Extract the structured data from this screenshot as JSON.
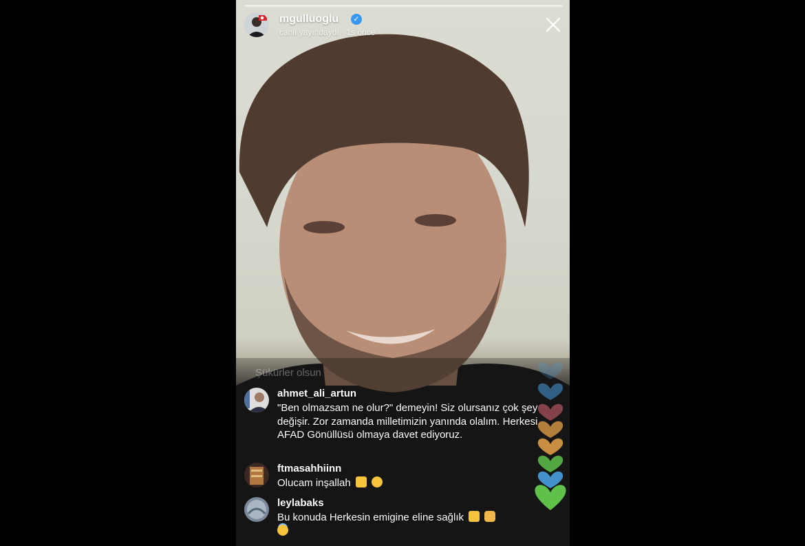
{
  "live": {
    "username": "mgulluoglu",
    "status": "canlı yayındaydı · 1s önce"
  },
  "faded_comment": "Şükürler olsun",
  "comments": [
    {
      "username": "ahmet_ali_artun",
      "text": "\"Ben olmazsam ne olur?\" demeyin! Siz olursanız çok şey değişir. Zor zamanda milletimizin yanında olalım. Herkesi AFAD Gönüllüsü olmaya davet ediyoruz."
    },
    {
      "username": "ftmasahhiinn",
      "text": "Olucam inşallah"
    },
    {
      "username": "leylabaks",
      "text": "Bu konuda Herkesin emigine eline sağlık"
    }
  ],
  "colors": {
    "verified": "#3897f0",
    "heart_green": "#5fc14a",
    "heart_blue": "#4a9fe0",
    "heart_orange": "#e8a34a",
    "heart_pink": "#e06a7a"
  },
  "icons": [
    "verified-badge-icon",
    "close-icon",
    "heart-icon",
    "thumbs-up-icon",
    "smile-emoji-icon",
    "pray-emoji-icon",
    "angel-emoji-icon"
  ]
}
